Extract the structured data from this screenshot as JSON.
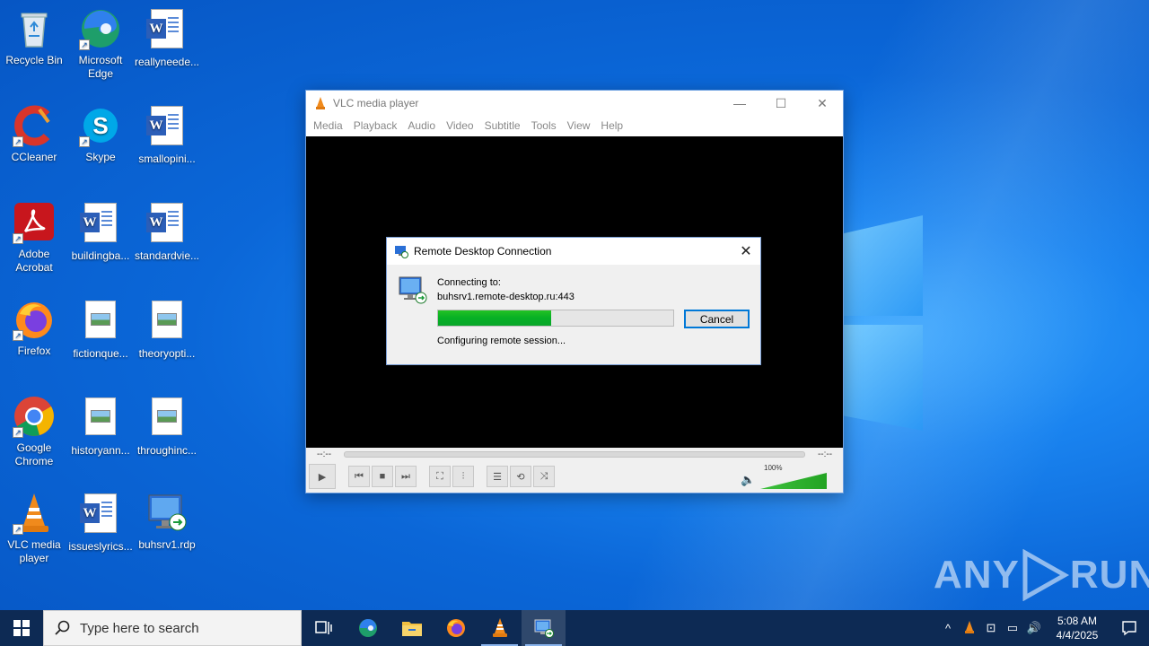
{
  "desktop": {
    "icons": [
      {
        "label": "Recycle Bin",
        "icon": "recycle-bin-icon"
      },
      {
        "label": "Microsoft Edge",
        "icon": "edge-icon"
      },
      {
        "label": "reallyneede...",
        "icon": "word-doc-icon"
      },
      {
        "label": "CCleaner",
        "icon": "ccleaner-icon"
      },
      {
        "label": "Skype",
        "icon": "skype-icon"
      },
      {
        "label": "smallopini...",
        "icon": "word-doc-icon"
      },
      {
        "label": "Adobe Acrobat",
        "icon": "acrobat-icon"
      },
      {
        "label": "buildingba...",
        "icon": "word-doc-icon"
      },
      {
        "label": "standardvie...",
        "icon": "word-doc-icon"
      },
      {
        "label": "Firefox",
        "icon": "firefox-icon"
      },
      {
        "label": "fictionque...",
        "icon": "image-file-icon"
      },
      {
        "label": "theoryopti...",
        "icon": "image-file-icon"
      },
      {
        "label": "Google Chrome",
        "icon": "chrome-icon"
      },
      {
        "label": "historyann...",
        "icon": "image-file-icon"
      },
      {
        "label": "throughinc...",
        "icon": "image-file-icon"
      },
      {
        "label": "VLC media player",
        "icon": "vlc-icon"
      },
      {
        "label": "issueslyrics...",
        "icon": "word-doc-icon"
      },
      {
        "label": "buhsrv1.rdp",
        "icon": "rdp-file-icon"
      }
    ]
  },
  "vlc": {
    "title": "VLC media player",
    "menu": [
      "Media",
      "Playback",
      "Audio",
      "Video",
      "Subtitle",
      "Tools",
      "View",
      "Help"
    ],
    "time_elapsed": "--:--",
    "time_remaining": "--:--",
    "volume_label": "100%",
    "volume_level": 1.0
  },
  "rdp_dialog": {
    "title": "Remote Desktop Connection",
    "connecting_label": "Connecting to:",
    "host": "buhsrv1.remote-desktop.ru:443",
    "status": "Configuring remote session...",
    "cancel_label": "Cancel",
    "progress": 0.48
  },
  "watermark": {
    "left": "ANY",
    "right": "RUN"
  },
  "taskbar": {
    "search_placeholder": "Type here to search",
    "apps": [
      "task-view-icon",
      "edge-icon",
      "file-explorer-icon",
      "firefox-icon",
      "vlc-icon",
      "remote-desktop-icon"
    ],
    "time": "5:08 AM",
    "date": "4/4/2025"
  },
  "colors": {
    "accent": "#0078d7",
    "progress_green": "#06b025",
    "taskbar": "#0d2a54"
  }
}
